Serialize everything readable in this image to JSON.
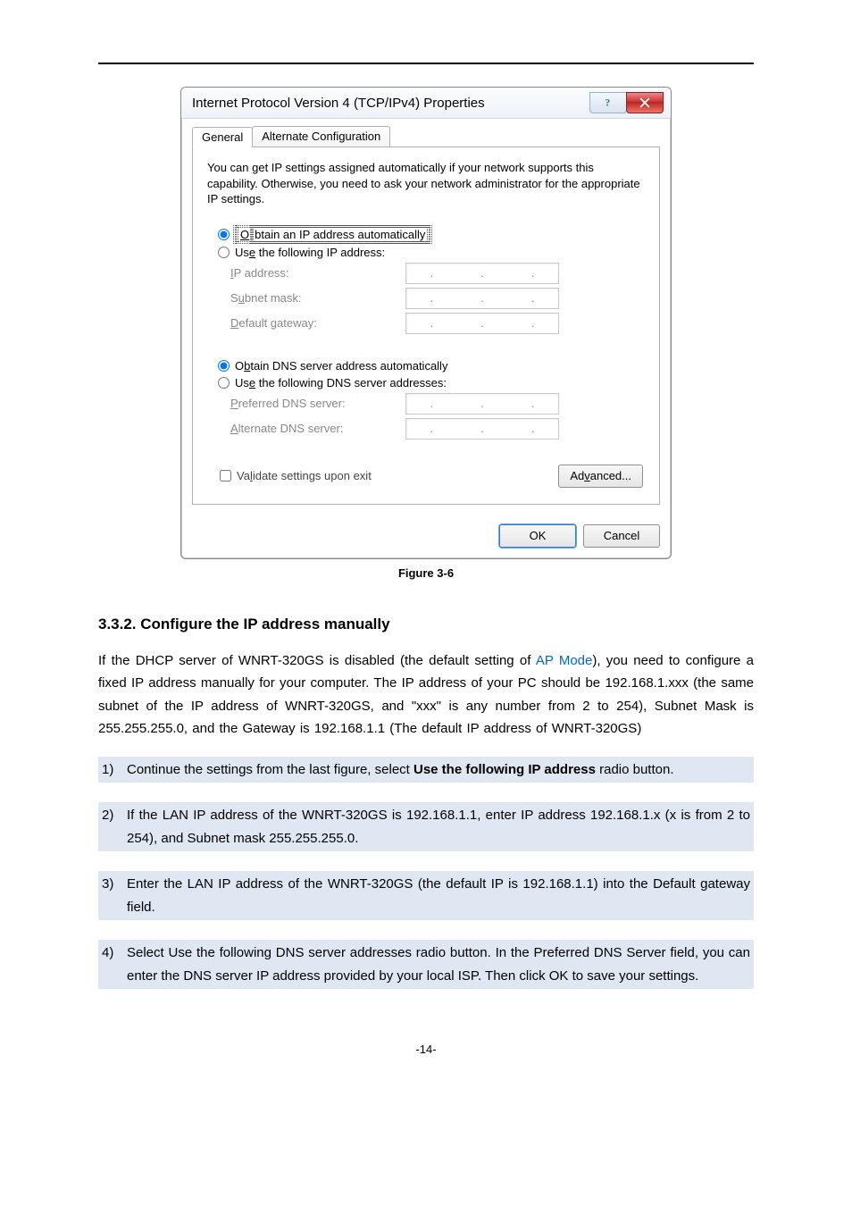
{
  "dialog": {
    "title": "Internet Protocol Version 4 (TCP/IPv4) Properties",
    "tabs": {
      "general": "General",
      "alt": "Alternate Configuration"
    },
    "desc": "You can get IP settings assigned automatically if your network supports this capability. Otherwise, you need to ask your network administrator for the appropriate IP settings.",
    "radio_ip_auto_pre": "O",
    "radio_ip_auto_post": "btain an IP address automatically",
    "radio_ip_manual_pre": "Us",
    "radio_ip_manual_u": "e",
    "radio_ip_manual_post": " the following IP address:",
    "ip_label_pre": "I",
    "ip_label": "P address:",
    "subnet_label_pre": "S",
    "subnet_label_u": "u",
    "subnet_label_post": "bnet mask:",
    "gateway_label_u": "D",
    "gateway_label_post": "efault gateway:",
    "radio_dns_auto_pre": "O",
    "radio_dns_auto_u": "b",
    "radio_dns_auto_post": "tain DNS server address automatically",
    "radio_dns_manual_pre": "Us",
    "radio_dns_manual_u": "e",
    "radio_dns_manual_post": " the following DNS server addresses:",
    "pref_dns_label_u": "P",
    "pref_dns_label_post": "referred DNS server:",
    "alt_dns_label_u": "A",
    "alt_dns_label_post": "lternate DNS server:",
    "validate_pre": "Va",
    "validate_u": "l",
    "validate_post": "idate settings upon exit",
    "advanced_pre": "Ad",
    "advanced_u": "v",
    "advanced_post": "anced...",
    "ok": "OK",
    "cancel": "Cancel"
  },
  "figure_caption": "Figure 3-6",
  "heading": "3.3.2.  Configure the IP address manually",
  "para_parts": {
    "a": "If the DHCP server of WNRT-320GS is disabled (the default setting of ",
    "link": "AP Mode",
    "b": "), you need to configure a fixed IP address manually for your computer. The IP address of your PC should be 192.168.1.xxx (the same subnet of the IP address of WNRT-320GS, and \"xxx\" is any number from 2 to 254), Subnet Mask is 255.255.255.0, and the Gateway is 192.168.1.1 (The default IP address of WNRT-320GS)"
  },
  "steps": {
    "n1": "1)",
    "s1_a": "Continue the settings from the last figure, select ",
    "s1_b": "Use the following IP address",
    "s1_c": " radio button.",
    "n2": "2)",
    "s2": "If the LAN IP address of the WNRT-320GS is 192.168.1.1, enter IP address 192.168.1.x (x is from 2 to 254), and Subnet mask 255.255.255.0.",
    "n3": "3)",
    "s3": "Enter the LAN IP address of the WNRT-320GS (the default IP is 192.168.1.1) into the Default gateway field.",
    "n4": "4)",
    "s4": "Select Use the following DNS server addresses radio button. In the Preferred DNS Server field, you can enter the DNS server IP address provided by your local ISP. Then click OK to save your settings."
  },
  "page_number": "-14-"
}
